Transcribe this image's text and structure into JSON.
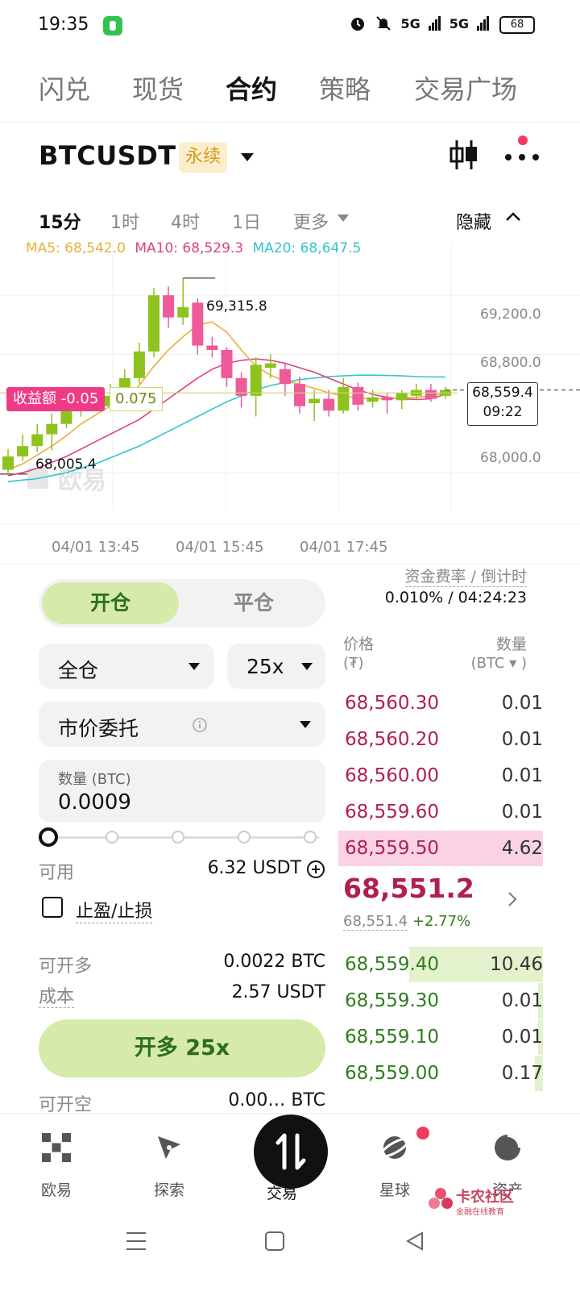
{
  "status": {
    "time": "19:35",
    "signal1": "5G",
    "signal2": "5G",
    "battery": "68"
  },
  "top_tabs": [
    "闪兑",
    "现货",
    "合约",
    "策略",
    "交易广场"
  ],
  "active_tab": 2,
  "pair": {
    "symbol": "BTCUSDT",
    "tag": "永续"
  },
  "timeframes": {
    "items": [
      "15分",
      "1时",
      "4时",
      "1日",
      "更多"
    ],
    "active": 0,
    "hide_label": "隐藏"
  },
  "chart_data": {
    "type": "candlestick",
    "ma": {
      "ma5_label": "MA5: 68,542.0",
      "ma10_label": "MA10: 68,529.3",
      "ma20_label": "MA20: 68,647.5"
    },
    "ma_colors": {
      "ma5": "#e8b03a",
      "ma10": "#e0427e",
      "ma20": "#36c2cf"
    },
    "up_color": "#8dc21f",
    "down_color": "#ef5a9a",
    "high_label": "69,315.8",
    "low_label": "68,005.4",
    "y_ticks": [
      "69,200.0",
      "68,800.0",
      "68,000.0"
    ],
    "y_tick_values": [
      69200,
      68800,
      68000
    ],
    "ylim": [
      67750,
      69550
    ],
    "x_labels": [
      "04/01 13:45",
      "04/01 15:45",
      "04/01 17:45"
    ],
    "current_price": "68,559.4",
    "countdown": "09:22",
    "pnl_label": "收益额 -0.05",
    "entry_label": "0.075",
    "entry_value": 68540,
    "watermark": "欧易",
    "candles": [
      {
        "o": 68020,
        "c": 68110,
        "h": 68160,
        "l": 67980
      },
      {
        "o": 68110,
        "c": 68180,
        "h": 68260,
        "l": 68080
      },
      {
        "o": 68180,
        "c": 68260,
        "h": 68330,
        "l": 68140
      },
      {
        "o": 68260,
        "c": 68330,
        "h": 68400,
        "l": 68150
      },
      {
        "o": 68330,
        "c": 68420,
        "h": 68480,
        "l": 68300
      },
      {
        "o": 68420,
        "c": 68500,
        "h": 68540,
        "l": 68380
      },
      {
        "o": 68500,
        "c": 68450,
        "h": 68560,
        "l": 68420
      },
      {
        "o": 68450,
        "c": 68520,
        "h": 68600,
        "l": 68420
      },
      {
        "o": 68520,
        "c": 68640,
        "h": 68700,
        "l": 68500
      },
      {
        "o": 68640,
        "c": 68820,
        "h": 68880,
        "l": 68600
      },
      {
        "o": 68820,
        "c": 69200,
        "h": 69250,
        "l": 68780
      },
      {
        "o": 69200,
        "c": 69050,
        "h": 69260,
        "l": 68980
      },
      {
        "o": 69050,
        "c": 69120,
        "h": 69315.8,
        "l": 69000
      },
      {
        "o": 69150,
        "c": 68860,
        "h": 69180,
        "l": 68800
      },
      {
        "o": 68860,
        "c": 68830,
        "h": 68920,
        "l": 68780
      },
      {
        "o": 68830,
        "c": 68640,
        "h": 68850,
        "l": 68580
      },
      {
        "o": 68640,
        "c": 68520,
        "h": 68680,
        "l": 68440
      },
      {
        "o": 68520,
        "c": 68730,
        "h": 68780,
        "l": 68380
      },
      {
        "o": 68710,
        "c": 68740,
        "h": 68800,
        "l": 68640
      },
      {
        "o": 68700,
        "c": 68600,
        "h": 68740,
        "l": 68520
      },
      {
        "o": 68600,
        "c": 68450,
        "h": 68650,
        "l": 68400
      },
      {
        "o": 68470,
        "c": 68500,
        "h": 68560,
        "l": 68350
      },
      {
        "o": 68500,
        "c": 68420,
        "h": 68560,
        "l": 68380
      },
      {
        "o": 68420,
        "c": 68580,
        "h": 68640,
        "l": 68400
      },
      {
        "o": 68580,
        "c": 68460,
        "h": 68610,
        "l": 68420
      },
      {
        "o": 68480,
        "c": 68510,
        "h": 68560,
        "l": 68440
      },
      {
        "o": 68510,
        "c": 68490,
        "h": 68540,
        "l": 68400
      },
      {
        "o": 68490,
        "c": 68540,
        "h": 68560,
        "l": 68430
      },
      {
        "o": 68520,
        "c": 68560,
        "h": 68600,
        "l": 68500
      },
      {
        "o": 68560,
        "c": 68500,
        "h": 68600,
        "l": 68480
      },
      {
        "o": 68520,
        "c": 68559.4,
        "h": 68580,
        "l": 68500
      }
    ],
    "ma5": [
      68020,
      68060,
      68120,
      68180,
      68250,
      68330,
      68390,
      68450,
      68510,
      68590,
      68720,
      68830,
      68920,
      69000,
      69020,
      68950,
      68830,
      68720,
      68660,
      68620,
      68600,
      68570,
      68540,
      68520,
      68505,
      68500,
      68500,
      68505,
      68510,
      68520,
      68540
    ],
    "ma10": [
      67980,
      68000,
      68030,
      68070,
      68110,
      68160,
      68210,
      68260,
      68310,
      68360,
      68430,
      68500,
      68570,
      68640,
      68700,
      68740,
      68760,
      68770,
      68760,
      68740,
      68710,
      68680,
      68640,
      68600,
      68560,
      68530,
      68510,
      68500,
      68495,
      68500,
      68530
    ],
    "ma20": [
      67940,
      67950,
      67960,
      67980,
      68000,
      68030,
      68060,
      68100,
      68140,
      68180,
      68230,
      68280,
      68330,
      68380,
      68430,
      68480,
      68520,
      68560,
      68590,
      68610,
      68630,
      68640,
      68650,
      68655,
      68660,
      68660,
      68658,
      68655,
      68650,
      68648,
      68647.5
    ]
  },
  "order": {
    "open_label": "开仓",
    "close_label": "平仓",
    "margin_mode": "全仓",
    "leverage": "25x",
    "order_type": "市价委托",
    "qty_label": "数量 (BTC)",
    "qty_value": "0.0009",
    "slider_level": 0,
    "available_label": "可用",
    "available_value": "6.32 USDT",
    "tpsl_label": "止盈/止损",
    "max_long_label": "可开多",
    "max_long_value": "0.0022 BTC",
    "cost_label": "成本",
    "cost_value": "2.57 USDT",
    "cta": "开多 25x",
    "cut_label": "可开空",
    "cut_value": "0.00… BTC"
  },
  "funding": {
    "label": "资金费率 / 倒计时",
    "value": "0.010% / 04:24:23"
  },
  "orderbook": {
    "price_header": "价格",
    "price_unit": "(₮)",
    "qty_header": "数量",
    "qty_unit": "(BTC ▾ )",
    "asks": [
      {
        "price": "68,560.30",
        "qty": "0.01"
      },
      {
        "price": "68,560.20",
        "qty": "0.01"
      },
      {
        "price": "68,560.00",
        "qty": "0.01"
      },
      {
        "price": "68,559.60",
        "qty": "0.01"
      },
      {
        "price": "68,559.50",
        "qty": "4.62"
      }
    ],
    "last_price": "68,551.2",
    "mark_price": "68,551.4",
    "change": "+2.77%",
    "bids": [
      {
        "price": "68,559.40",
        "qty": "10.46"
      },
      {
        "price": "68,559.30",
        "qty": "0.01"
      },
      {
        "price": "68,559.10",
        "qty": "0.01"
      },
      {
        "price": "68,559.00",
        "qty": "0.17"
      }
    ]
  },
  "bottom_nav": [
    "欧易",
    "探索",
    "交易",
    "星球",
    "资产"
  ],
  "watermark_brand": {
    "title": "卡农社区",
    "subtitle": "金融在线教育"
  }
}
